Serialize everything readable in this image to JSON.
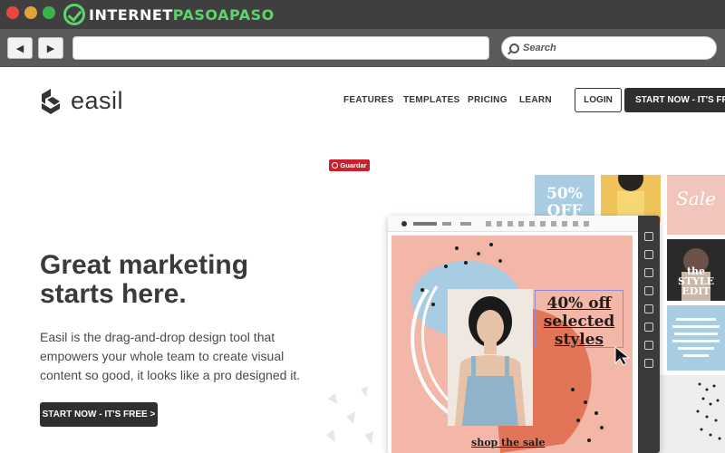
{
  "browser": {
    "brand_prefix": "INTERNET",
    "brand_accent": "PASOAPASO",
    "back_icon": "◀",
    "forward_icon": "▶",
    "search_placeholder": "Search"
  },
  "pin": {
    "label": "Guardar"
  },
  "site": {
    "name": "easil",
    "nav": [
      {
        "label": "FEATURES"
      },
      {
        "label": "TEMPLATES"
      },
      {
        "label": "PRICING"
      },
      {
        "label": "LEARN"
      }
    ],
    "login_label": "LOGIN",
    "start_label": "START NOW - IT'S FREE"
  },
  "hero": {
    "title": "Great marketing\nstarts here.",
    "body": "Easil is the drag-and-drop design tool that empowers your whole team to create visual content so good, it looks like a pro designed it.",
    "cta_label": "START NOW - IT'S FREE >"
  },
  "artwork": {
    "offer_text": "40% off\nselected\nstyles",
    "shop_text": "shop the sale",
    "tile_offer": "50%\nOFF",
    "tile_sale": "Sale",
    "tile_style": "the\nSTYLE\nEDIT"
  },
  "colors": {
    "chrome": "#3f3f3f",
    "brand_green": "#5fd36b",
    "dark_button": "#2f2f2f",
    "canvas_pink": "#f3b7a8",
    "accent_blue": "#a8cde2",
    "pin_red": "#cc1f2c"
  }
}
